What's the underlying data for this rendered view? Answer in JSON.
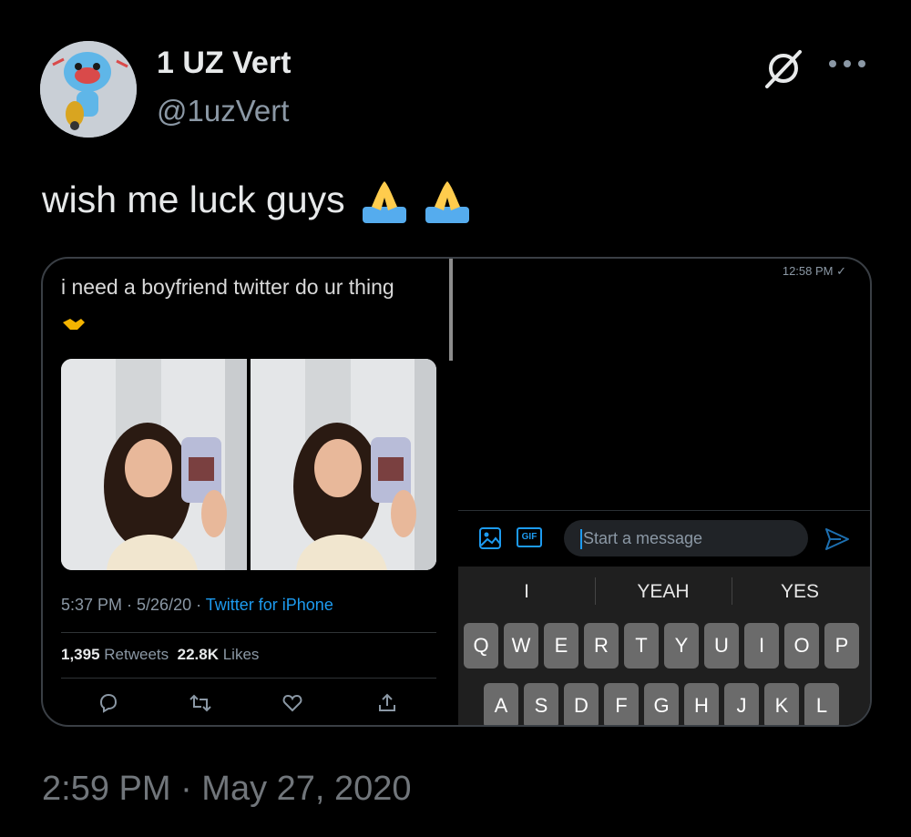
{
  "author": {
    "display_name": "1 UZ Vert",
    "handle": "@1uzVert"
  },
  "tweet": {
    "text": "wish me luck guys",
    "emoji": [
      "folded-hands",
      "folded-hands"
    ]
  },
  "embedded_screenshot": {
    "quoted_tweet": {
      "text": "i need a boyfriend twitter do ur thing",
      "meta_time": "5:37 PM · 5/26/20 · ",
      "meta_source": "Twitter for iPhone",
      "retweets_count": "1,395",
      "retweets_label": "Retweets",
      "likes_count": "22.8K",
      "likes_label": "Likes"
    },
    "dm": {
      "sent_time": "12:58 PM ✓",
      "placeholder": "Start a message",
      "gif_label": "GIF"
    },
    "keyboard": {
      "suggestions": [
        "I",
        "YEAH",
        "YES"
      ],
      "row1": [
        "Q",
        "W",
        "E",
        "R",
        "T",
        "Y",
        "U",
        "I",
        "O",
        "P"
      ],
      "row2": [
        "A",
        "S",
        "D",
        "F",
        "G",
        "H",
        "J",
        "K",
        "L"
      ]
    }
  },
  "timestamp": "2:59 PM · May 27, 2020",
  "icons": [
    "grok-icon",
    "more-icon",
    "reply-icon",
    "retweet-icon",
    "like-icon",
    "share-icon",
    "image-icon",
    "gif-icon",
    "send-icon"
  ],
  "colors": {
    "background": "#000000",
    "link": "#1d9bf0",
    "secondary_text": "#8b98a5"
  }
}
